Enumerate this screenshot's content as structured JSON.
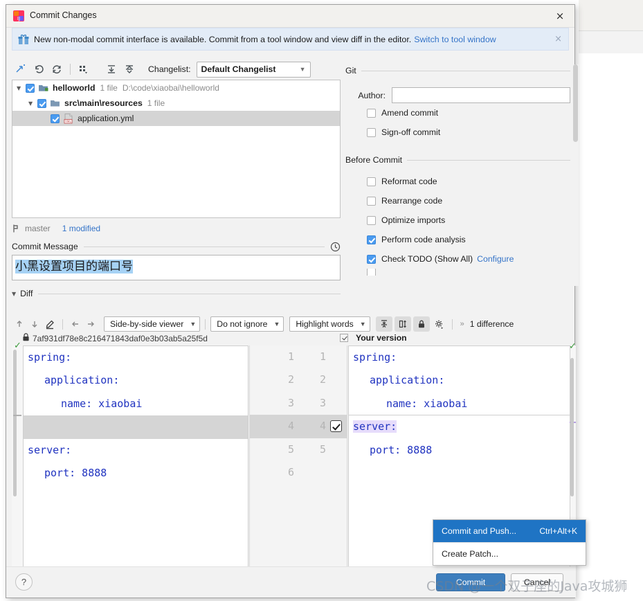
{
  "window": {
    "title": "Commit Changes",
    "app_icon": "intellij-idea-icon",
    "close_label": "×"
  },
  "notification": {
    "icon": "gift-icon",
    "message": "New non-modal commit interface is available. Commit from a tool window and view diff in the editor.",
    "link": "Switch to tool window",
    "dismiss": "×"
  },
  "changelist_toolbar": {
    "buttons": [
      {
        "name": "show-diff-icon",
        "glyph": "⤵"
      },
      {
        "name": "rollback-icon",
        "glyph": "↶"
      },
      {
        "name": "refresh-icon",
        "glyph": "↻"
      },
      {
        "name": "group-by-icon",
        "glyph": "∷"
      },
      {
        "name": "expand-all-icon",
        "glyph": "↧"
      },
      {
        "name": "collapse-all-icon",
        "glyph": "↥"
      }
    ],
    "changelist_label": "Changelist:",
    "changelist_value": "Default Changelist"
  },
  "tree": {
    "nodes": [
      {
        "label": "helloworld",
        "meta": "1 file",
        "path": "D:\\code\\xiaobai\\helloworld",
        "checked": true,
        "expanded": true,
        "icon": "module-icon",
        "selected": false,
        "depth": 0
      },
      {
        "label": "src\\main\\resources",
        "meta": "1 file",
        "path": "",
        "checked": true,
        "expanded": true,
        "icon": "folder-icon",
        "selected": false,
        "depth": 1
      },
      {
        "label": "application.yml",
        "meta": "",
        "path": "",
        "checked": true,
        "expanded": null,
        "icon": "yml-file-icon",
        "selected": true,
        "depth": 2
      }
    ]
  },
  "branch_status": {
    "icon": "git-branch-icon",
    "branch": "master",
    "modified": "1 modified"
  },
  "commit_message": {
    "label": "Commit Message",
    "history_icon": "clock-icon",
    "value": "小黑设置项目的端口号"
  },
  "diff_section": {
    "label": "Diff",
    "expanded": true
  },
  "git_panel": {
    "group_label": "Git",
    "author_label": "Author:",
    "author_value": "",
    "checkboxes": [
      {
        "label": "Amend commit",
        "checked": false
      },
      {
        "label": "Sign-off commit",
        "checked": false
      }
    ]
  },
  "before_commit_panel": {
    "group_label": "Before Commit",
    "checkboxes": [
      {
        "label": "Reformat code",
        "checked": false,
        "link": ""
      },
      {
        "label": "Rearrange code",
        "checked": false,
        "link": ""
      },
      {
        "label": "Optimize imports",
        "checked": false,
        "link": ""
      },
      {
        "label": "Perform code analysis",
        "checked": true,
        "link": ""
      },
      {
        "label": "Check TODO (Show All)",
        "checked": true,
        "link": "Configure"
      }
    ]
  },
  "diff_toolbar": {
    "nav": [
      {
        "name": "previous-difference-icon",
        "glyph": "↑"
      },
      {
        "name": "next-difference-icon",
        "glyph": "↓"
      },
      {
        "name": "edit-source-icon",
        "glyph": "✎"
      },
      {
        "name": "accept-left-icon",
        "glyph": "←"
      },
      {
        "name": "accept-right-icon",
        "glyph": "→"
      }
    ],
    "viewer_mode": "Side-by-side viewer",
    "ignore_mode": "Do not ignore",
    "highlight_mode": "Highlight words",
    "toggles": [
      {
        "name": "collapse-unchanged-icon",
        "glyph": "⩝",
        "active": true
      },
      {
        "name": "synchronize-scroll-icon",
        "glyph": "↕",
        "active": true
      },
      {
        "name": "read-only-lock-icon",
        "glyph": "ὑ2",
        "active": true
      }
    ],
    "settings_icon": "gear-icon",
    "more_icon": "chevron-double-right-icon",
    "difference_count": "1 difference"
  },
  "diff_versions": {
    "left_lock_icon": "lock-icon",
    "left_title": "7af931df78e8c216471843daf0e3b03ab5a25f5d",
    "right_checkbox_checked": true,
    "right_title": "Your version"
  },
  "diff_content": {
    "left_lines": [
      {
        "n": "1",
        "indent": 0,
        "text": "spring:",
        "kind": "key"
      },
      {
        "n": "2",
        "indent": 1,
        "text": "application:",
        "kind": "key"
      },
      {
        "n": "3",
        "indent": 2,
        "text": "name: xiaobai",
        "kind": "keyval"
      },
      {
        "n": "4",
        "indent": 0,
        "text": "",
        "kind": "blank-change"
      },
      {
        "n": "5",
        "indent": 0,
        "text": "server:",
        "kind": "key"
      },
      {
        "n": "6",
        "indent": 1,
        "text": "port: 8888",
        "kind": "keynum"
      }
    ],
    "right_lines": [
      {
        "n": "1",
        "indent": 0,
        "text": "spring:",
        "kind": "key"
      },
      {
        "n": "2",
        "indent": 1,
        "text": "application:",
        "kind": "key"
      },
      {
        "n": "3",
        "indent": 2,
        "text": "name: xiaobai",
        "kind": "keyval"
      },
      {
        "n": "4",
        "indent": 0,
        "text": "server:",
        "kind": "key-highlight"
      },
      {
        "n": "5",
        "indent": 1,
        "text": "port: 8888",
        "kind": "keynum"
      }
    ],
    "line_numbers": [
      {
        "left": "1",
        "right": "1",
        "changed": false,
        "accept": false
      },
      {
        "left": "2",
        "right": "2",
        "changed": false,
        "accept": false
      },
      {
        "left": "3",
        "right": "3",
        "changed": false,
        "accept": false
      },
      {
        "left": "4",
        "right": "4",
        "changed": true,
        "accept": true
      },
      {
        "left": "5",
        "right": "5",
        "changed": false,
        "accept": false
      },
      {
        "left": "6",
        "right": "",
        "changed": false,
        "accept": false
      }
    ]
  },
  "context_menu": {
    "items": [
      {
        "label": "Commit and Push...",
        "accel": "Ctrl+Alt+K",
        "active": true
      },
      {
        "label": "Create Patch...",
        "accel": "",
        "active": false
      }
    ]
  },
  "footer": {
    "help_label": "?",
    "commit_label": "Commit",
    "cancel_label": "Cancel"
  },
  "watermark": {
    "text": "CSDN @一个双子座的Java攻城狮"
  },
  "colors": {
    "accent": "#3574c8",
    "checkbox_on": "#4a9bf0",
    "primary_button": "#3d7ebd",
    "selection": "#a6d2f5",
    "notification_bg": "#e3ecf7",
    "menu_highlight": "#1f74c4",
    "diff_change": "#d5d5d5",
    "word_highlight": "#e6dcfb"
  }
}
